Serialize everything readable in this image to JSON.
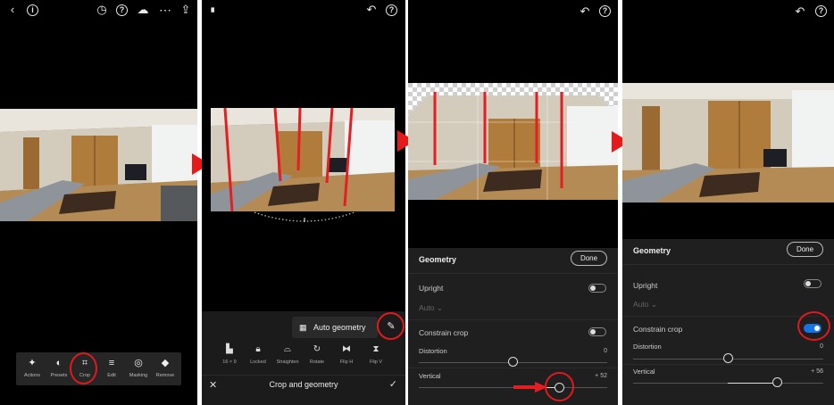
{
  "panel1": {
    "toolbar": [
      {
        "label": "Actions",
        "icon": "magic-wand-icon",
        "glyph": "✦"
      },
      {
        "label": "Presets",
        "icon": "presets-icon",
        "glyph": "◐"
      },
      {
        "label": "Crop",
        "icon": "crop-icon",
        "glyph": "⌗"
      },
      {
        "label": "Edit",
        "icon": "sliders-icon",
        "glyph": "≡"
      },
      {
        "label": "Masking",
        "icon": "masking-icon",
        "glyph": "◎"
      },
      {
        "label": "Remove",
        "icon": "eraser-icon",
        "glyph": "◆"
      }
    ]
  },
  "panel2": {
    "auto_geometry_label": "Auto geometry",
    "tools": [
      {
        "label": "16 × 9",
        "icon": "aspect-ratio-icon",
        "glyph": "▙"
      },
      {
        "label": "Locked",
        "icon": "lock-icon",
        "glyph": "🔒︎"
      },
      {
        "label": "Straighten",
        "icon": "straighten-icon",
        "glyph": "⌓"
      },
      {
        "label": "Rotate",
        "icon": "rotate-icon",
        "glyph": "↻"
      },
      {
        "label": "Flip H",
        "icon": "flip-horizontal-icon",
        "glyph": "⧓"
      },
      {
        "label": "Flip V",
        "icon": "flip-vertical-icon",
        "glyph": "⧗"
      }
    ],
    "footer_title": "Crop and geometry"
  },
  "panel3": {
    "title": "Geometry",
    "done_label": "Done",
    "upright_label": "Upright",
    "upright_value": "Auto",
    "constrain_label": "Constrain crop",
    "constrain_on": false,
    "distortion_label": "Distortion",
    "distortion_value": "0",
    "vertical_label": "Vertical",
    "vertical_value": "+ 52"
  },
  "panel4": {
    "title": "Geometry",
    "done_label": "Done",
    "upright_label": "Upright",
    "upright_value": "Auto",
    "constrain_label": "Constrain crop",
    "constrain_on": true,
    "distortion_label": "Distortion",
    "distortion_value": "0",
    "vertical_label": "Vertical",
    "vertical_value": "+ 56"
  },
  "colors": {
    "annotation_red": "#e0191e",
    "toggle_blue": "#1473e6"
  }
}
